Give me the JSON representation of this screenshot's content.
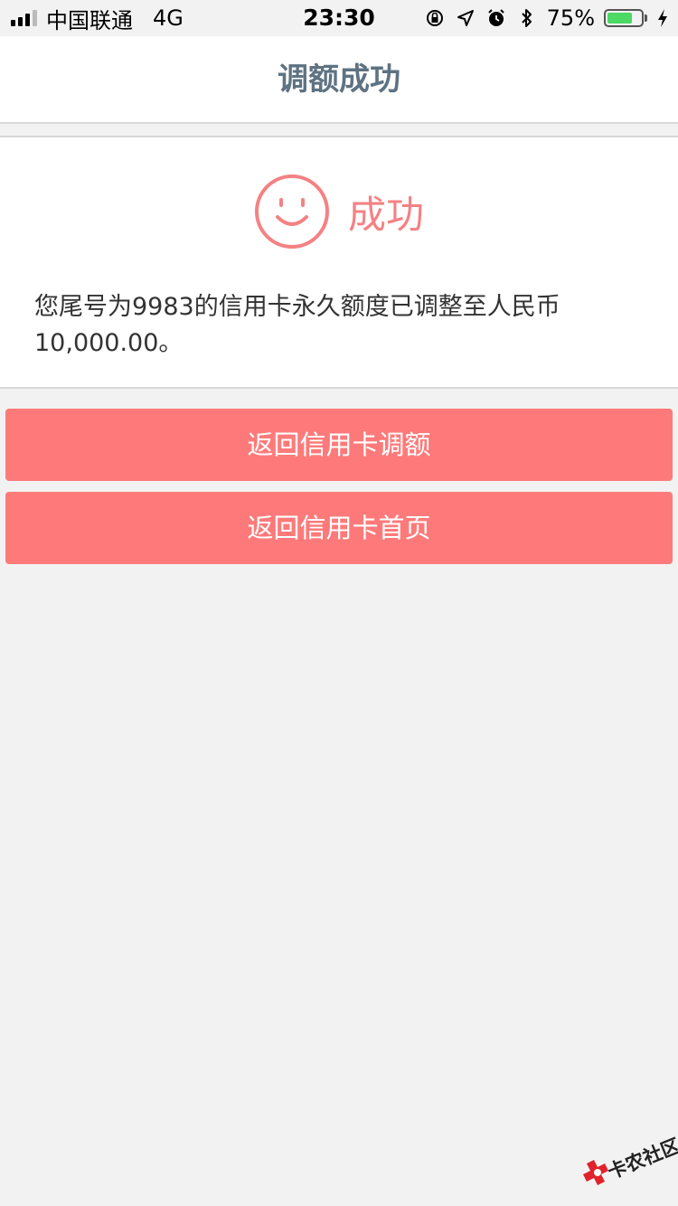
{
  "status_bar": {
    "carrier": "中国联通",
    "network": "4G",
    "time": "23:30",
    "battery_percent_label": "75%",
    "battery_level": 0.75,
    "icons": [
      "orientation-lock-icon",
      "location-icon",
      "alarm-icon",
      "bluetooth-icon",
      "charging-icon"
    ]
  },
  "nav": {
    "title": "调额成功"
  },
  "result": {
    "status_text": "成功",
    "message": "您尾号为9983的信用卡永久额度已调整至人民币 10,000.00。"
  },
  "buttons": {
    "back_to_adjust": "返回信用卡调额",
    "back_to_home": "返回信用卡首页"
  },
  "watermark": {
    "text": "卡农社区"
  },
  "colors": {
    "accent": "#fe7a7a",
    "success": "#f48184",
    "title": "#5e7282",
    "background": "#f2f2f2"
  }
}
